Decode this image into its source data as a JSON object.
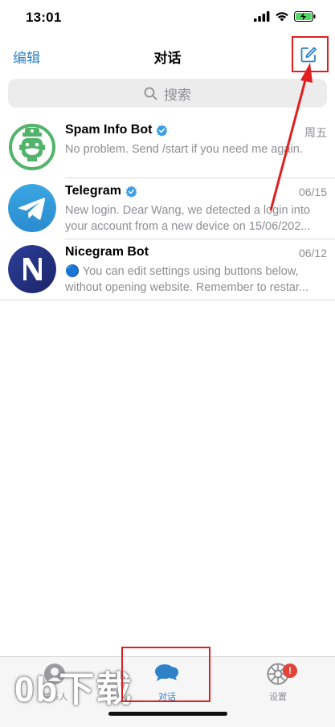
{
  "status": {
    "time": "13:01"
  },
  "nav": {
    "edit": "编辑",
    "title": "对话"
  },
  "search": {
    "placeholder": "搜索"
  },
  "chats": [
    {
      "name": "Spam Info Bot",
      "verified": true,
      "date": "周五",
      "message": "No problem. Send /start if you need me again.",
      "avatar": "spam-bot-avatar"
    },
    {
      "name": "Telegram",
      "verified": true,
      "date": "06/15",
      "message": "New login. Dear Wang, we detected a login into your account from a new device on 15/06/202...",
      "avatar": "telegram-avatar"
    },
    {
      "name": "Nicegram Bot",
      "verified": false,
      "date": "06/12",
      "message": "🔵 You can edit settings using buttons below, without opening website. Remember to restar...",
      "avatar": "nicegram-avatar"
    }
  ],
  "tabs": {
    "contacts": "联系人",
    "chats": "对话",
    "settings": "设置",
    "settings_badge": "!"
  },
  "watermark": "0b下载",
  "colors": {
    "accent": "#2f82c8",
    "highlight": "#e02020"
  }
}
